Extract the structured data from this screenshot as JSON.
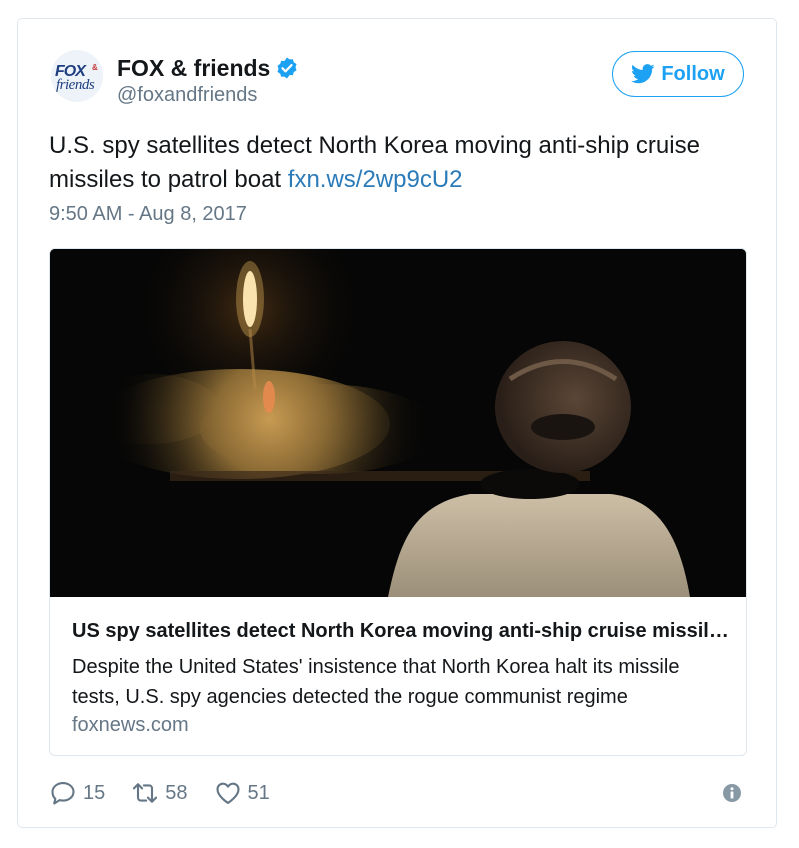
{
  "tweet": {
    "display_name": "FOX & friends",
    "handle": "@foxandfriends",
    "avatar": {
      "line1": "FOX",
      "amp": "&",
      "line2": "friends"
    },
    "follow_label": "Follow",
    "text_main": "U.S. spy satellites detect North Korea moving anti-ship cruise missiles to patrol boat ",
    "text_link": "fxn.ws/2wp9cU2",
    "timestamp": "9:50 AM - Aug 8, 2017"
  },
  "card": {
    "title": "US spy satellites detect North Korea moving anti-ship cruise missiles to patrol boat",
    "description": "Despite the United States' insistence that North Korea halt its missile tests, U.S. spy agencies detected the rogue communist regime",
    "domain": "foxnews.com"
  },
  "actions": {
    "replies": "15",
    "retweets": "58",
    "likes": "51"
  },
  "colors": {
    "accent": "#1da1f2",
    "link": "#2b7bb9",
    "muted": "#657786",
    "border": "#e1e8ed"
  },
  "icons": [
    "verified-badge-icon",
    "twitter-bird-icon",
    "reply-icon",
    "retweet-icon",
    "heart-icon",
    "info-icon"
  ]
}
